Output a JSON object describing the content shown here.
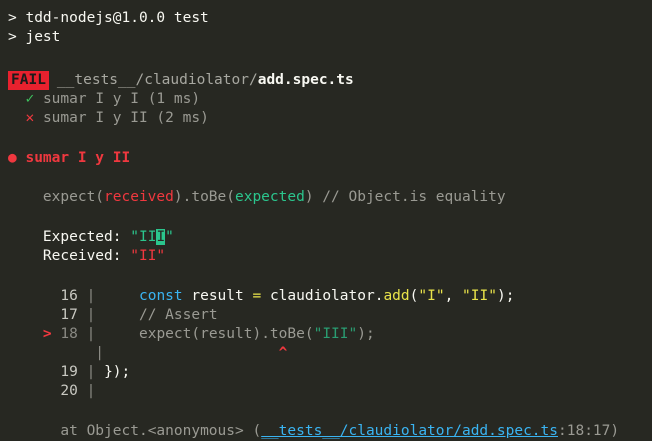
{
  "npm": {
    "prompt1": "> tdd-nodejs@1.0.0 test",
    "prompt2": "> jest"
  },
  "suite": {
    "status_badge": "FAIL",
    "path_dir": "__tests__/claudiolator/",
    "path_file": "add.spec.ts"
  },
  "tests": [
    {
      "mark": "✓",
      "name": "sumar I y I (1 ms)"
    },
    {
      "mark": "✕",
      "name": "sumar I y II (2 ms)"
    }
  ],
  "failure": {
    "bullet": "●",
    "title": "sumar I y II",
    "expect_prefix": "expect(",
    "expect_received": "received",
    "expect_mid": ").toBe(",
    "expect_expected": "expected",
    "expect_suffix": ")",
    "expect_comment": " // Object.is equality",
    "expected_label": "Expected: ",
    "expected_value_pre": "\"II",
    "expected_value_hl": "I",
    "expected_value_post": "\"",
    "received_label": "Received: ",
    "received_value": "\"II\""
  },
  "code": {
    "l16_num": "16",
    "l16_kw": "const",
    "l16_a": " result ",
    "l16_eq": "=",
    "l16_b": " claudiolator.",
    "l16_fn": "add",
    "l16_c": "(",
    "l16_s1": "\"I\"",
    "l16_d": ", ",
    "l16_s2": "\"II\"",
    "l16_e": ");",
    "l17_num": "17",
    "l17_comment": "// Assert",
    "l18_marker": ">",
    "l18_num": "18",
    "l18_a": "expect(result).toBe(",
    "l18_s": "\"III\"",
    "l18_b": ");",
    "caret": "^",
    "l19_num": "19",
    "l19_text": "});",
    "l20_num": "20"
  },
  "location": {
    "prefix": "at Object.<anonymous> (",
    "path": "__tests__/claudiolator/add.spec.ts",
    "pos": ":18:17",
    "suffix": ")"
  }
}
